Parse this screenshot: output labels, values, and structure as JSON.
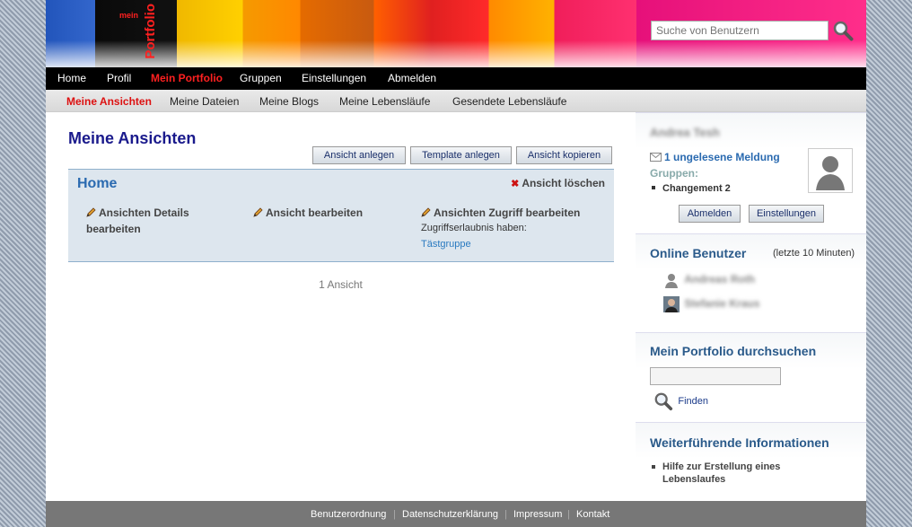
{
  "header": {
    "logo_small": "mein",
    "logo_big": "Portfolio",
    "search_placeholder": "Suche von Benutzern"
  },
  "main_nav": [
    "Home",
    "Profil",
    "Mein Portfolio",
    "Gruppen",
    "Einstellungen",
    "Abmelden"
  ],
  "main_nav_active": "Mein Portfolio",
  "sub_nav": [
    "Meine Ansichten",
    "Meine Dateien",
    "Meine Blogs",
    "Meine Lebensläufe",
    "Gesendete Lebensläufe"
  ],
  "sub_nav_active": "Meine Ansichten",
  "content": {
    "title": "Meine Ansichten",
    "buttons": {
      "create_view": "Ansicht anlegen",
      "create_template": "Template anlegen",
      "copy_view": "Ansicht kopieren"
    },
    "view": {
      "name": "Home",
      "delete_label": "Ansicht löschen",
      "edit_details": "Ansichten Details bearbeiten",
      "edit_view": "Ansicht bearbeiten",
      "edit_access": "Ansichten Zugriff bearbeiten",
      "access_label": "Zugriffserlaubnis haben:",
      "access_group": "Tästgruppe"
    },
    "count": "1 Ansicht"
  },
  "sidebar": {
    "user": {
      "name_blurred": "Andrea Tesh",
      "unread": "1 ungelesene Meldung",
      "groups_label": "Gruppen:",
      "groups": [
        "Changement 2"
      ],
      "logout": "Abmelden",
      "settings": "Einstellungen"
    },
    "online": {
      "title": "Online Benutzer",
      "note": "(letzte 10 Minuten)",
      "users_blurred": [
        "Andreas Roth",
        "Stefanie Kraus"
      ]
    },
    "search": {
      "title": "Mein Portfolio durchsuchen",
      "button": "Finden"
    },
    "info": {
      "title": "Weiterführende Informationen",
      "items": [
        "Hilfe zur Erstellung eines Lebenslaufes"
      ]
    }
  },
  "footer": [
    "Benutzerordnung",
    "Datenschutzerklärung",
    "Impressum",
    "Kontakt"
  ],
  "colors": {
    "accent_red": "#ff2020",
    "title_blue": "#1a1a8c",
    "link_blue": "#2a6ab0",
    "footer_gray": "#777777"
  }
}
